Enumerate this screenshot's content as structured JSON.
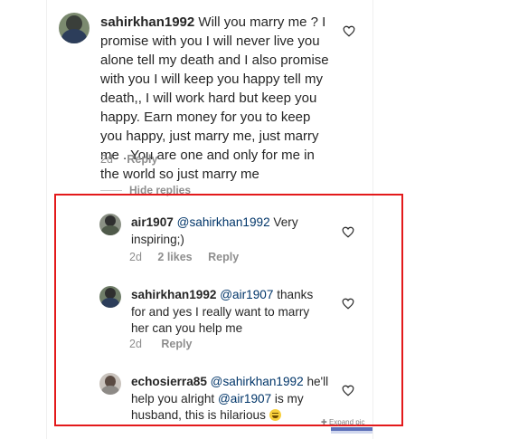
{
  "comments": [
    {
      "username": "sahirkhan1992",
      "text": "Will you marry me ? I promise with you I will never live you alone tell my death and I also promise with you I will keep you happy tell my death,, I will work hard but keep you happy. Earn money for you to keep you happy, just marry me, just marry me . You are one and only for me in the world so just marry me",
      "time": "2d",
      "reply": "Reply",
      "like_icon": "heart-outline-icon"
    }
  ],
  "hide_replies": "Hide replies",
  "replies": [
    {
      "username": "air1907",
      "mention": "@sahirkhan1992",
      "text": "Very inspiring;)",
      "time": "2d",
      "likes": "2 likes",
      "reply": "Reply",
      "like_icon": "heart-outline-icon"
    },
    {
      "username": "sahirkhan1992",
      "mention": "@air1907",
      "text": "thanks for and yes I really want to marry her can you help me",
      "time": "2d",
      "reply": "Reply",
      "like_icon": "heart-outline-icon"
    },
    {
      "username": "echosierra85",
      "mention": "@sahirkhan1992",
      "text_a": "he'll help you alright",
      "mention2": "@air1907",
      "text_b": "is my husband, this is hilarious",
      "emoji": "grinning-face-emoji",
      "like_icon": "heart-outline-icon"
    }
  ],
  "expand_label": "Expand pic",
  "colors": {
    "highlight": "#e3191b",
    "mention": "#003569",
    "meta": "#8e8e8e"
  }
}
